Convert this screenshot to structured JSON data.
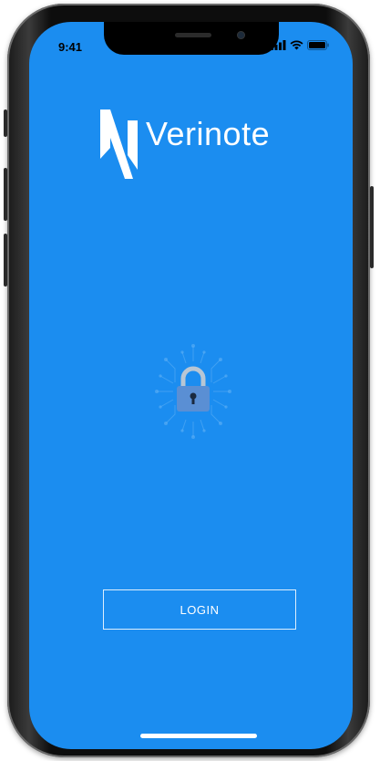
{
  "status_bar": {
    "time": "9:41",
    "icons": [
      "signal-icon",
      "wifi-icon",
      "battery-icon"
    ]
  },
  "brand": {
    "name": "Verinote",
    "mark_letter": "N",
    "background_color": "#1b8df0"
  },
  "center": {
    "icon": "lock-icon"
  },
  "login": {
    "label": "LOGIN"
  }
}
